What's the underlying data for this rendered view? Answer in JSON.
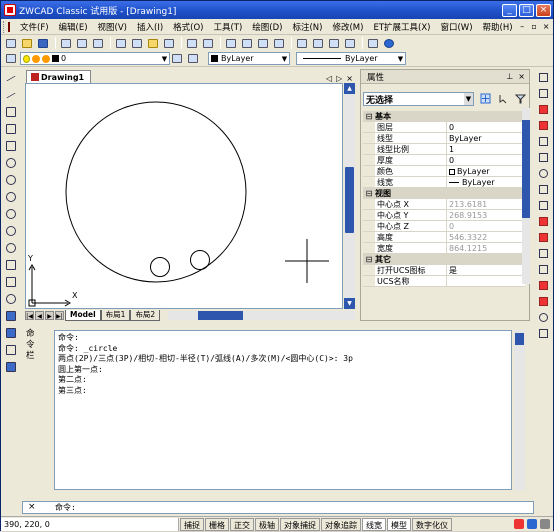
{
  "window": {
    "title": "ZWCAD Classic 试用版 - [Drawing1]"
  },
  "menu": {
    "items": [
      "文件(F)",
      "编辑(E)",
      "视图(V)",
      "插入(I)",
      "格式(O)",
      "工具(T)",
      "绘图(D)",
      "标注(N)",
      "修改(M)",
      "ET扩展工具(X)",
      "窗口(W)",
      "帮助(H)"
    ]
  },
  "layer_toolbar": {
    "layer_name": "0",
    "color_value": "ByLayer",
    "linetype_value": "ByLayer"
  },
  "drawing": {
    "tab_title": "Drawing1",
    "ucs_x_label": "X",
    "ucs_y_label": "Y",
    "layout_tabs": [
      "Model",
      "布局1",
      "布局2"
    ]
  },
  "properties": {
    "title": "属性",
    "selection": "无选择",
    "categories": [
      {
        "name": "基本",
        "rows": [
          {
            "key": "图层",
            "value": "0"
          },
          {
            "key": "线型",
            "value": "ByLayer"
          },
          {
            "key": "线型比例",
            "value": "1"
          },
          {
            "key": "厚度",
            "value": "0"
          },
          {
            "key": "颜色",
            "value": "ByLayer",
            "swatch": "color"
          },
          {
            "key": "线宽",
            "value": "ByLayer",
            "swatch": "line"
          }
        ]
      },
      {
        "name": "视图",
        "rows": [
          {
            "key": "中心点 X",
            "value": "213.6181",
            "readonly": true
          },
          {
            "key": "中心点 Y",
            "value": "268.9153",
            "readonly": true
          },
          {
            "key": "中心点 Z",
            "value": "0",
            "readonly": true
          },
          {
            "key": "高度",
            "value": "546.3322",
            "readonly": true
          },
          {
            "key": "宽度",
            "value": "864.1215",
            "readonly": true
          }
        ]
      },
      {
        "name": "其它",
        "rows": [
          {
            "key": "打开UCS图标",
            "value": "是"
          },
          {
            "key": "UCS名称",
            "value": ""
          }
        ]
      }
    ]
  },
  "command": {
    "side_label": "命令栏",
    "history": [
      "命令:",
      "命令: _circle",
      "两点(2P)/三点(3P)/相切-相切-半径(T)/弧线(A)/多次(M)/<圆中心(C)>: 3p",
      "圆上第一点:",
      "第二点:",
      "第三点:"
    ],
    "prompt": "命令:"
  },
  "status": {
    "coords": "390, 220, 0",
    "toggles": [
      "捕捉",
      "栅格",
      "正交",
      "极轴",
      "对象捕捉",
      "对象追踪",
      "线宽",
      "模型",
      "数字化仪"
    ]
  }
}
